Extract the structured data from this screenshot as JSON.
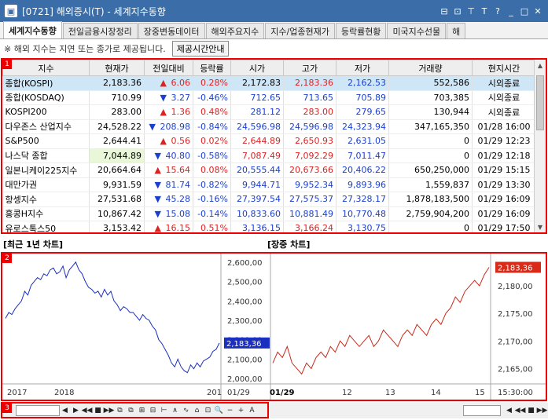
{
  "window": {
    "title": "[0721] 해외증시(T) - 세계지수동향",
    "controls": [
      "⊟",
      "⊡",
      "⊤",
      "T",
      "?",
      "_",
      "□",
      "✕"
    ]
  },
  "tabs": [
    {
      "label": "세계지수동향",
      "active": true
    },
    {
      "label": "전일금융시장정리",
      "active": false
    },
    {
      "label": "장중변동데이터",
      "active": false
    },
    {
      "label": "해외주요지수",
      "active": false
    },
    {
      "label": "지수/업종현재가",
      "active": false
    },
    {
      "label": "등락률현황",
      "active": false
    },
    {
      "label": "미국지수선물",
      "active": false
    },
    {
      "label": "해",
      "active": false
    }
  ],
  "notice": {
    "text": "※ 해외 지수는 지연 또는 종가로 제공됩니다.",
    "button": "제공시간안내"
  },
  "table": {
    "columns": [
      "지수",
      "현재가",
      "전일대비",
      "등락률",
      "시가",
      "고가",
      "저가",
      "거래량",
      "현지시간"
    ],
    "rows": [
      {
        "name": "종합(KOSPI)",
        "price": "2,183.36",
        "dir": "up",
        "chg": "6.06",
        "rate": "0.28%",
        "open": "2,172.83",
        "high": "2,183.36",
        "low": "2,162.53",
        "vol": "552,586",
        "time": "시외종료",
        "sel": true,
        "oc": "",
        "hc": "up",
        "lc": "dn"
      },
      {
        "name": "종합(KOSDAQ)",
        "price": "710.99",
        "dir": "dn",
        "chg": "3.27",
        "rate": "-0.46%",
        "open": "712.65",
        "high": "713.65",
        "low": "705.89",
        "vol": "703,385",
        "time": "시외종료",
        "oc": "dn",
        "hc": "dn",
        "lc": "dn"
      },
      {
        "name": "KOSPI200",
        "price": "283.00",
        "dir": "up",
        "chg": "1.36",
        "rate": "0.48%",
        "open": "281.12",
        "high": "283.00",
        "low": "279.65",
        "vol": "130,944",
        "time": "시외종료",
        "oc": "dn",
        "hc": "up",
        "lc": "dn"
      },
      {
        "name": "다우존스 산업지수",
        "price": "24,528.22",
        "dir": "dn",
        "chg": "208.98",
        "rate": "-0.84%",
        "open": "24,596.98",
        "high": "24,596.98",
        "low": "24,323.94",
        "vol": "347,165,350",
        "time": "01/28 16:00",
        "oc": "dn",
        "hc": "dn",
        "lc": "dn"
      },
      {
        "name": "S&P500",
        "price": "2,644.41",
        "dir": "up",
        "chg": "0.56",
        "rate": "0.02%",
        "open": "2,644.89",
        "high": "2,650.93",
        "low": "2,631.05",
        "vol": "0",
        "time": "01/29 12:23",
        "oc": "up",
        "hc": "up",
        "lc": "dn"
      },
      {
        "name": "나스닥 종합",
        "price": "7,044.89",
        "dir": "dn",
        "chg": "40.80",
        "rate": "-0.58%",
        "open": "7,087.49",
        "high": "7,092.29",
        "low": "7,011.47",
        "vol": "0",
        "time": "01/29 12:18",
        "hl": true,
        "oc": "up",
        "hc": "up",
        "lc": "dn"
      },
      {
        "name": "일본니케이225지수",
        "price": "20,664.64",
        "dir": "up",
        "chg": "15.64",
        "rate": "0.08%",
        "open": "20,555.44",
        "high": "20,673.66",
        "low": "20,406.22",
        "vol": "650,250,000",
        "time": "01/29 15:15",
        "oc": "dn",
        "hc": "up",
        "lc": "dn"
      },
      {
        "name": "대만가권",
        "price": "9,931.59",
        "dir": "dn",
        "chg": "81.74",
        "rate": "-0.82%",
        "open": "9,944.71",
        "high": "9,952.34",
        "low": "9,893.96",
        "vol": "1,559,837",
        "time": "01/29 13:30",
        "oc": "dn",
        "hc": "dn",
        "lc": "dn"
      },
      {
        "name": "항셍지수",
        "price": "27,531.68",
        "dir": "dn",
        "chg": "45.28",
        "rate": "-0.16%",
        "open": "27,397.54",
        "high": "27,575.37",
        "low": "27,328.17",
        "vol": "1,878,183,500",
        "time": "01/29 16:09",
        "oc": "dn",
        "hc": "dn",
        "lc": "dn"
      },
      {
        "name": "홍콩H지수",
        "price": "10,867.42",
        "dir": "dn",
        "chg": "15.08",
        "rate": "-0.14%",
        "open": "10,833.60",
        "high": "10,881.49",
        "low": "10,770.48",
        "vol": "2,759,904,200",
        "time": "01/29 16:09",
        "oc": "dn",
        "hc": "dn",
        "lc": "dn"
      },
      {
        "name": "유로스톡스50",
        "price": "3,153.42",
        "dir": "up",
        "chg": "16.15",
        "rate": "0.51%",
        "open": "3,136.15",
        "high": "3,166.24",
        "low": "3,130.75",
        "vol": "0",
        "time": "01/29 17:50",
        "oc": "dn",
        "hc": "up",
        "lc": "dn"
      }
    ]
  },
  "chart_titles": {
    "left": "[최근 1년 차트]",
    "right": "[장중 차트]"
  },
  "chart_data": [
    {
      "type": "line",
      "xticks": [
        "2017",
        "2018",
        "201"
      ],
      "ytick_labels": [
        "2,600,00",
        "2,500,00",
        "2,400,00",
        "2,300,00",
        "2,200,00",
        "2,100,00",
        "2,000,00"
      ],
      "yticks": [
        2600,
        2500,
        2400,
        2300,
        2200,
        2100,
        2000
      ],
      "ylim": [
        1980,
        2620
      ],
      "last_value_label": "2,183,36",
      "series": [
        {
          "color": "#1a2fbf",
          "values": [
            2310,
            2340,
            2330,
            2360,
            2380,
            2400,
            2450,
            2430,
            2480,
            2500,
            2520,
            2510,
            2540,
            2530,
            2560,
            2570,
            2540,
            2550,
            2580,
            2520,
            2560,
            2580,
            2600,
            2560,
            2540,
            2500,
            2470,
            2460,
            2440,
            2450,
            2420,
            2460,
            2430,
            2450,
            2400,
            2380,
            2350,
            2370,
            2360,
            2340,
            2340,
            2320,
            2300,
            2330,
            2310,
            2300,
            2270,
            2250,
            2200,
            2180,
            2150,
            2120,
            2080,
            2060,
            2100,
            2060,
            2040,
            2030,
            2070,
            2050,
            2080,
            2060,
            2090,
            2100,
            2110,
            2140,
            2150,
            2183
          ]
        }
      ]
    },
    {
      "type": "line",
      "xticks": [
        "01/29",
        "12",
        "13",
        "14",
        "15",
        "15:30:00"
      ],
      "ytick_labels": [
        "2,180,00",
        "2,175,00",
        "2,170,00",
        "2,165,00"
      ],
      "yticks": [
        2180,
        2175,
        2170,
        2165
      ],
      "ylim": [
        2162.5,
        2185
      ],
      "last_value_label": "2,183,36",
      "series": [
        {
          "color": "#c62a1a",
          "values": [
            2166,
            2168,
            2167,
            2169,
            2166,
            2165,
            2164,
            2166,
            2165,
            2167,
            2168,
            2167,
            2169,
            2168,
            2170,
            2169,
            2171,
            2170,
            2169,
            2170,
            2171,
            2169,
            2170,
            2172,
            2171,
            2170,
            2169,
            2171,
            2172,
            2171,
            2173,
            2172,
            2171,
            2173,
            2174,
            2173,
            2175,
            2176,
            2178,
            2177,
            2179,
            2180,
            2181,
            2180,
            2182,
            2183.36
          ]
        }
      ]
    }
  ],
  "toolbar_icons": [
    "◀",
    "▶",
    "◀◀",
    "■",
    "▶▶",
    "⧉",
    "⧉",
    "⊞",
    "⊟",
    "⊢",
    "∧",
    "∿",
    "⌂",
    "⊡",
    "🔍",
    "−",
    "+",
    "A"
  ],
  "toolbar_right": [
    "◀",
    "◀◀",
    "■",
    "▶▶"
  ]
}
